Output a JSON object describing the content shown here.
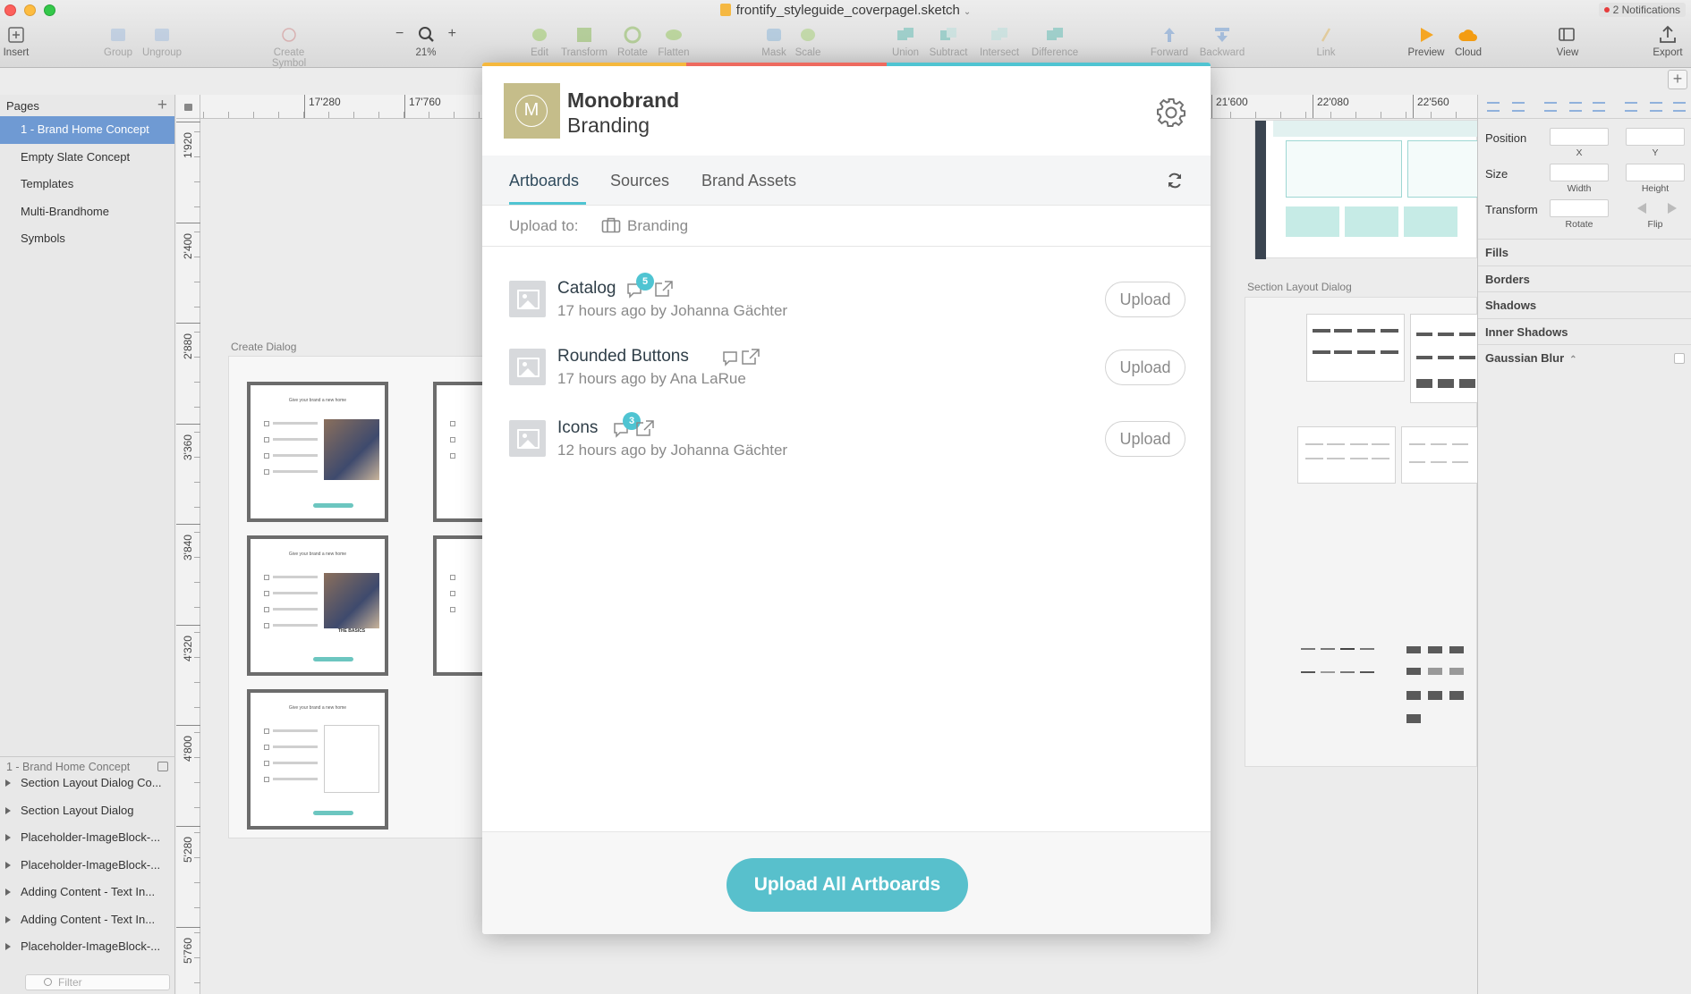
{
  "window": {
    "title": "frontify_styleguide_coverpagel.sketch",
    "notifications": "2 Notifications"
  },
  "toolbar": [
    {
      "label": "Insert",
      "icon": "plus-icon",
      "enabled": true
    },
    {
      "label": "Group",
      "icon": "group-icon",
      "enabled": false
    },
    {
      "label": "Ungroup",
      "icon": "ungroup-icon",
      "enabled": false
    },
    {
      "label": "Create Symbol",
      "icon": "symbol-icon",
      "enabled": false
    },
    {
      "label": "21%",
      "icon": "zoom-icon",
      "enabled": true
    },
    {
      "label": "Edit",
      "icon": "edit-icon",
      "enabled": false
    },
    {
      "label": "Transform",
      "icon": "transform-icon",
      "enabled": false
    },
    {
      "label": "Rotate",
      "icon": "rotate-icon",
      "enabled": false
    },
    {
      "label": "Flatten",
      "icon": "flatten-icon",
      "enabled": false
    },
    {
      "label": "Mask",
      "icon": "mask-icon",
      "enabled": false
    },
    {
      "label": "Scale",
      "icon": "scale-icon",
      "enabled": false
    },
    {
      "label": "Union",
      "icon": "union-icon",
      "enabled": false
    },
    {
      "label": "Subtract",
      "icon": "subtract-icon",
      "enabled": false
    },
    {
      "label": "Intersect",
      "icon": "intersect-icon",
      "enabled": false
    },
    {
      "label": "Difference",
      "icon": "difference-icon",
      "enabled": false
    },
    {
      "label": "Forward",
      "icon": "forward-icon",
      "enabled": false
    },
    {
      "label": "Backward",
      "icon": "backward-icon",
      "enabled": false
    },
    {
      "label": "Link",
      "icon": "link-icon",
      "enabled": false
    },
    {
      "label": "Preview",
      "icon": "preview-icon",
      "enabled": true
    },
    {
      "label": "Cloud",
      "icon": "cloud-icon",
      "enabled": true
    },
    {
      "label": "View",
      "icon": "view-icon",
      "enabled": true
    },
    {
      "label": "Export",
      "icon": "export-icon",
      "enabled": true
    }
  ],
  "zoom": {
    "minus": "−",
    "plus": "+"
  },
  "sidebar": {
    "pages_title": "Pages",
    "pages": [
      "1 - Brand Home Concept",
      "Empty Slate Concept",
      "Templates",
      "Multi-Brandhome",
      "Symbols"
    ],
    "active_page": 0,
    "layers_title": "1 - Brand Home Concept",
    "layers": [
      "Section Layout Dialog Co...",
      "Section Layout Dialog",
      "Placeholder-ImageBlock-...",
      "Placeholder-ImageBlock-...",
      "Adding Content -  Text In...",
      "Adding Content -  Text In...",
      "Placeholder-ImageBlock-..."
    ],
    "filter_placeholder": "Filter"
  },
  "rulers": {
    "top": [
      "17'280",
      "17'760",
      "21'600",
      "22'080",
      "22'560"
    ],
    "left": [
      "1'920",
      "2'400",
      "2'880",
      "3'360",
      "3'840",
      "4'320",
      "4'800",
      "5'280",
      "5'760"
    ]
  },
  "canvas": {
    "create_dialog_label": "Create Dialog",
    "section_layout_label": "Section Layout Dialog",
    "thumb_title": "Give your brand a new home",
    "thumb_caption": "THE BASICS"
  },
  "inspector": {
    "position": "Position",
    "x": "X",
    "y": "Y",
    "size": "Size",
    "width": "Width",
    "height": "Height",
    "transform": "Transform",
    "rotate": "Rotate",
    "flip": "Flip",
    "sections": [
      "Fills",
      "Borders",
      "Shadows",
      "Inner Shadows",
      "Gaussian Blur"
    ]
  },
  "modal": {
    "brand_initial": "M",
    "brand_name": "Monobrand",
    "brand_sub": "Branding",
    "tabs": [
      "Artboards",
      "Sources",
      "Brand Assets"
    ],
    "active_tab": 0,
    "upload_to_label": "Upload to:",
    "upload_to_dest": "Branding",
    "artboards": [
      {
        "name": "Catalog",
        "meta": "17 hours ago by Johanna Gächter",
        "comments": "5",
        "button": "Upload"
      },
      {
        "name": "Rounded Buttons",
        "meta": "17 hours ago by Ana LaRue",
        "comments": "",
        "button": "Upload"
      },
      {
        "name": "Icons",
        "meta": "12 hours ago by Johanna Gächter",
        "comments": "3",
        "button": "Upload"
      }
    ],
    "upload_all": "Upload All Artboards",
    "bar_colors": [
      "#f5b83d",
      "#ee6a5f",
      "#4fc4d2"
    ]
  },
  "colors": {
    "accent": "#58c0cc",
    "selection": "#6f9ad3",
    "brand_logo": "#c5bd8a"
  }
}
